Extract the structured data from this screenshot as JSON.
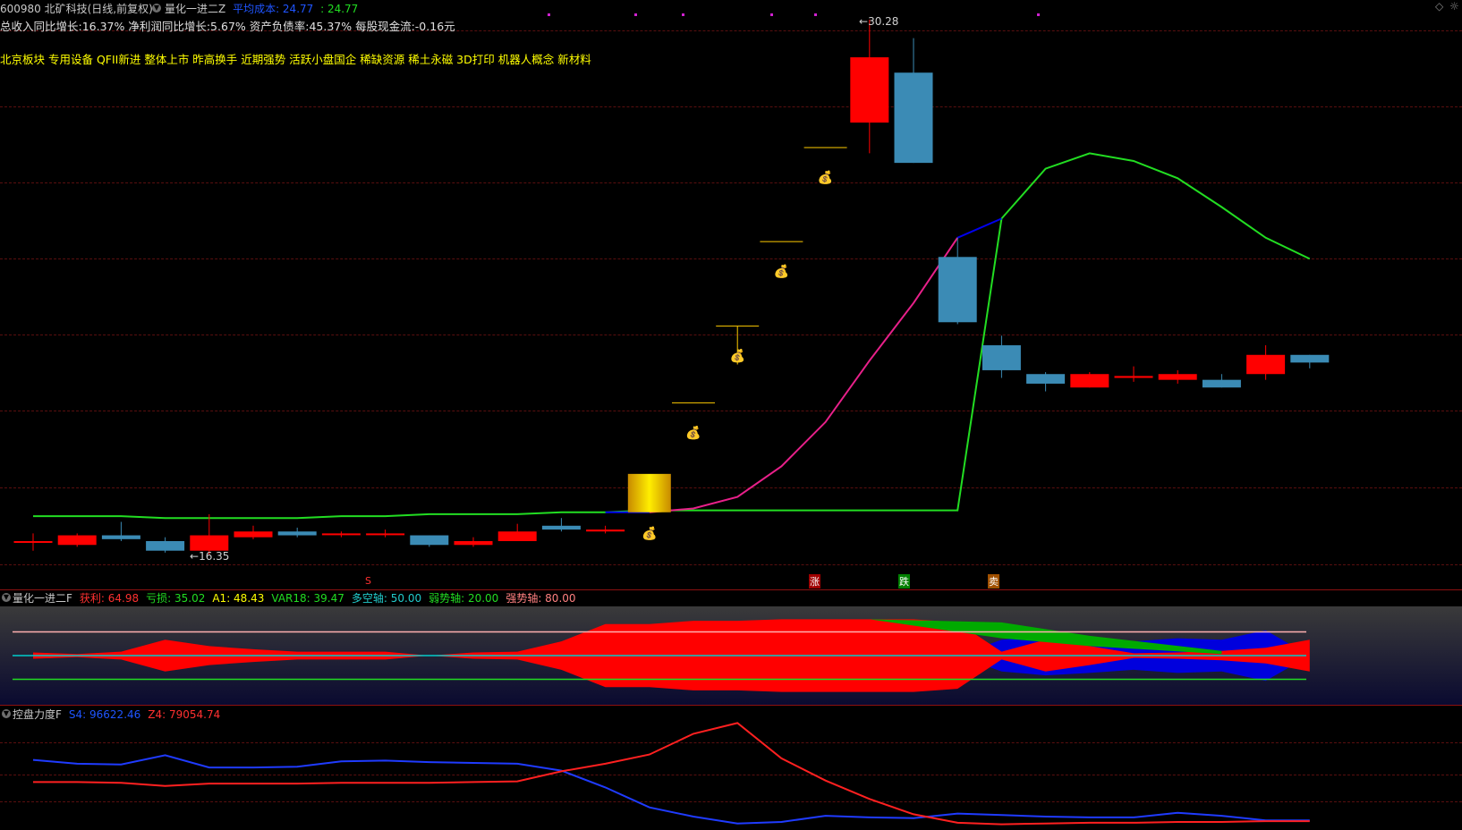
{
  "header": {
    "title_left": "600980 北矿科技(日线,前复权)",
    "indicator_name": "量化一进二Z",
    "cost_label": "平均成本: 24.77",
    "cost_value": ": 24.77"
  },
  "fundamentals": {
    "line": "总收入同比增长:16.37%  净利润同比增长:5.67%  资产负债率:45.37%  每股现金流:-0.16元"
  },
  "concepts": {
    "line": "北京板块 专用设备 QFII新进 整体上市 昨高换手 近期强势 活跃小盘国企 稀缺资源 稀土永磁 3D打印 机器人概念 新材料"
  },
  "price_labels": {
    "high": "30.28",
    "low": "16.35"
  },
  "signal_marks": {
    "s": "S",
    "zhang": "涨",
    "die": "跌",
    "mai": "卖"
  },
  "pane2": {
    "name": "量化一进二F",
    "profit": "获利: 64.98",
    "loss": "亏损: 35.02",
    "a1": "A1: 48.43",
    "var18": "VAR18: 39.47",
    "axis": "多空轴: 50.00",
    "weak": "弱势轴: 20.00",
    "strong": "强势轴: 80.00"
  },
  "pane3": {
    "name": "控盘力度F",
    "s4": "S4: 96622.46",
    "z4": "Z4: 79054.74"
  },
  "colors": {
    "up": "#ff0000",
    "down": "#3b8bb5",
    "green_ma": "#22dd22",
    "pink_ma": "#e8208a",
    "blue": "#0000ee",
    "gold": "#ffcc00"
  },
  "chart_data": {
    "type": "candlestick",
    "candles": [
      {
        "o": 16.7,
        "h": 16.9,
        "l": 16.45,
        "c": 16.7
      },
      {
        "o": 16.6,
        "h": 16.9,
        "l": 16.55,
        "c": 16.85
      },
      {
        "o": 16.85,
        "h": 17.2,
        "l": 16.7,
        "c": 16.75
      },
      {
        "o": 16.7,
        "h": 16.8,
        "l": 16.4,
        "c": 16.45
      },
      {
        "o": 16.45,
        "h": 17.4,
        "l": 16.35,
        "c": 16.85
      },
      {
        "o": 16.8,
        "h": 17.1,
        "l": 16.75,
        "c": 16.95
      },
      {
        "o": 16.95,
        "h": 17.05,
        "l": 16.8,
        "c": 16.85
      },
      {
        "o": 16.9,
        "h": 16.95,
        "l": 16.8,
        "c": 16.9
      },
      {
        "o": 16.9,
        "h": 17.0,
        "l": 16.8,
        "c": 16.9
      },
      {
        "o": 16.85,
        "h": 16.85,
        "l": 16.55,
        "c": 16.6
      },
      {
        "o": 16.6,
        "h": 16.8,
        "l": 16.55,
        "c": 16.7
      },
      {
        "o": 16.7,
        "h": 17.15,
        "l": 16.7,
        "c": 16.95
      },
      {
        "o": 17.1,
        "h": 17.3,
        "l": 16.95,
        "c": 17.0
      },
      {
        "o": 16.95,
        "h": 17.1,
        "l": 16.9,
        "c": 17.0
      },
      {
        "o": 17.45,
        "h": 18.45,
        "l": 17.45,
        "c": 18.45
      },
      {
        "o": 20.3,
        "h": 20.3,
        "l": 20.3,
        "c": 20.3
      },
      {
        "o": 22.3,
        "h": 22.3,
        "l": 21.3,
        "c": 22.3
      },
      {
        "o": 24.5,
        "h": 24.5,
        "l": 24.5,
        "c": 24.5
      },
      {
        "o": 26.95,
        "h": 26.95,
        "l": 26.95,
        "c": 26.95
      },
      {
        "o": 27.6,
        "h": 30.28,
        "l": 26.8,
        "c": 29.3
      },
      {
        "o": 28.9,
        "h": 29.8,
        "l": 26.55,
        "c": 26.55
      },
      {
        "o": 24.1,
        "h": 24.6,
        "l": 22.35,
        "c": 22.4
      },
      {
        "o": 21.8,
        "h": 22.05,
        "l": 20.95,
        "c": 21.15
      },
      {
        "o": 21.05,
        "h": 21.1,
        "l": 20.6,
        "c": 20.8
      },
      {
        "o": 20.7,
        "h": 21.1,
        "l": 20.7,
        "c": 21.05
      },
      {
        "o": 20.95,
        "h": 21.25,
        "l": 20.85,
        "c": 21.0
      },
      {
        "o": 20.9,
        "h": 21.15,
        "l": 20.8,
        "c": 21.05
      },
      {
        "o": 20.9,
        "h": 21.05,
        "l": 20.7,
        "c": 20.7
      },
      {
        "o": 21.05,
        "h": 21.8,
        "l": 20.9,
        "c": 21.55
      },
      {
        "o": 21.55,
        "h": 21.55,
        "l": 21.2,
        "c": 21.35
      }
    ],
    "green_line": [
      17.35,
      17.35,
      17.35,
      17.3,
      17.3,
      17.3,
      17.3,
      17.35,
      17.35,
      17.4,
      17.4,
      17.4,
      17.45,
      17.45,
      17.5,
      17.5,
      17.5,
      17.5,
      17.5,
      17.5,
      17.5,
      17.5,
      25.1,
      26.4,
      26.8,
      26.6,
      26.15,
      25.4,
      24.6,
      24.05
    ],
    "pink_line": [
      null,
      null,
      null,
      null,
      null,
      null,
      null,
      null,
      null,
      null,
      null,
      null,
      null,
      null,
      17.45,
      17.55,
      17.85,
      18.65,
      19.8,
      21.4,
      22.9,
      24.6,
      null,
      null,
      null,
      null,
      null,
      null,
      null,
      null
    ],
    "pane2_levels": {
      "strong": 80,
      "axis": 50,
      "weak": 20
    },
    "pane2_profit": [
      54,
      52,
      55,
      30,
      62,
      58,
      55,
      55,
      55,
      50,
      46,
      55,
      68,
      90,
      90,
      94,
      94,
      96,
      96,
      96,
      96,
      92,
      45,
      30,
      38,
      47,
      46,
      44,
      40,
      70
    ],
    "pane2_blue": [
      50,
      50,
      48,
      30,
      50,
      50,
      50,
      50,
      50,
      50,
      50,
      50,
      50,
      50,
      50,
      50,
      50,
      50,
      50,
      50,
      50,
      50,
      70,
      75,
      72,
      68,
      72,
      70,
      82,
      50
    ],
    "pane3_s4": [
      96800,
      96300,
      96200,
      97400,
      95800,
      95800,
      95900,
      96600,
      96700,
      96500,
      96400,
      96300,
      95400,
      93200,
      90600,
      89400,
      88500,
      88700,
      89500,
      89300,
      89200,
      89800,
      89600,
      89400,
      89300,
      89300,
      89900,
      89500,
      88900,
      88900
    ],
    "pane3_z4": [
      93900,
      93900,
      93800,
      93400,
      93700,
      93700,
      93700,
      93800,
      93800,
      93800,
      93900,
      94000,
      95300,
      96300,
      97500,
      100200,
      101600,
      97000,
      94100,
      91700,
      89700,
      88600,
      88400,
      88500,
      88600,
      88600,
      88700,
      88700,
      88800,
      88800
    ]
  }
}
